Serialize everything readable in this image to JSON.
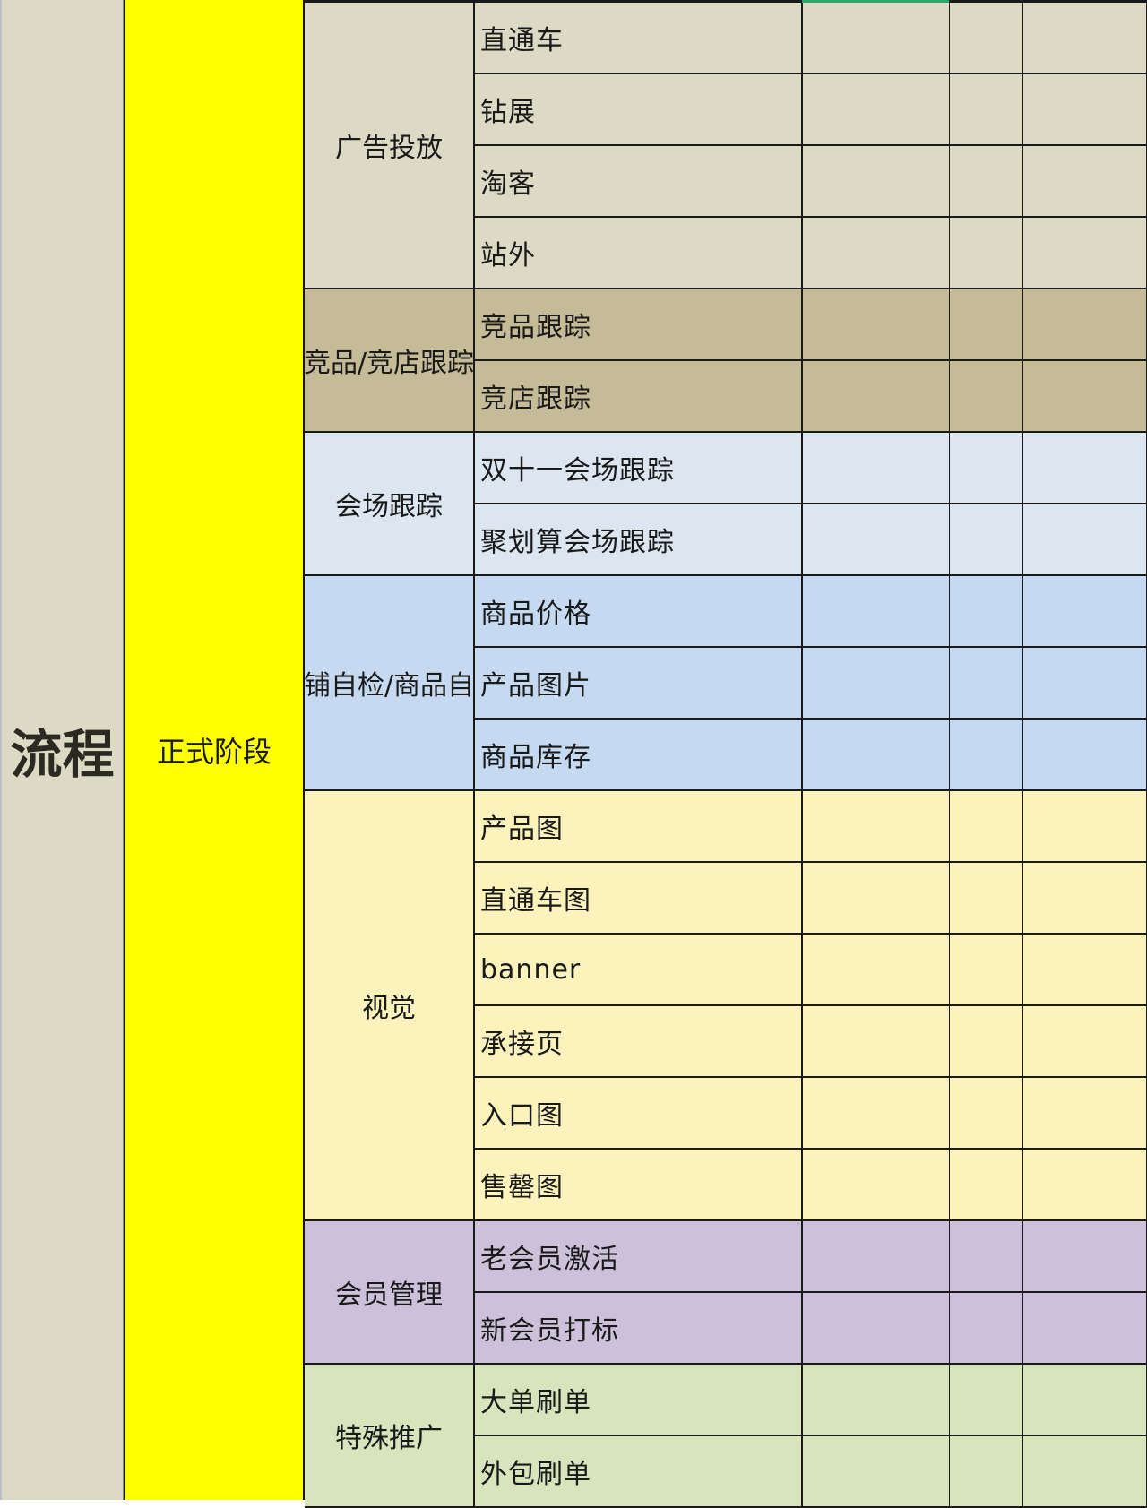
{
  "process_label": "流程",
  "phase_label": "正式阶段",
  "groups": [
    {
      "name": "广告投放",
      "color": "#dcd9c4",
      "items": [
        "直通车",
        "钻展",
        "淘客",
        "站外"
      ]
    },
    {
      "name": "竞品/竞店跟踪",
      "color": "#c5bc97",
      "items": [
        "竞品跟踪",
        "竞店跟踪"
      ]
    },
    {
      "name": "会场跟踪",
      "color": "#dce6f1",
      "items": [
        "双十一会场跟踪",
        "聚划算会场跟踪"
      ]
    },
    {
      "name": "店铺自检/商品自检",
      "color": "#c5d9f1",
      "items": [
        "商品价格",
        "产品图片",
        "商品库存"
      ]
    },
    {
      "name": "视觉",
      "color": "#fbf3bb",
      "items": [
        "产品图",
        "直通车图",
        "banner",
        "承接页",
        "入口图",
        "售罄图"
      ]
    },
    {
      "name": "会员管理",
      "color": "#ccc0da",
      "items": [
        "老会员激活",
        "新会员打标"
      ]
    },
    {
      "name": "特殊推广",
      "color": "#d8e4bc",
      "items": [
        "大单刷单",
        "外包刷单"
      ]
    }
  ]
}
